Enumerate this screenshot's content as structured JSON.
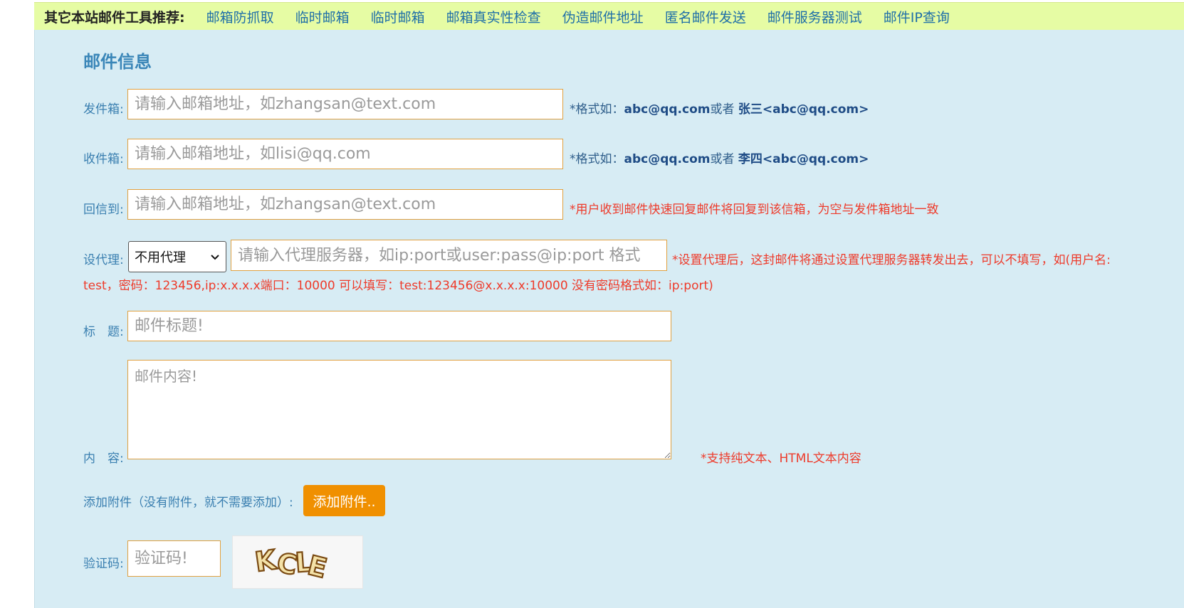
{
  "nav": {
    "title": "其它本站邮件工具推荐:",
    "links": [
      "邮箱防抓取",
      "临时邮箱",
      "临时邮箱",
      "邮箱真实性检查",
      "伪造邮件地址",
      "匿名邮件发送",
      "邮件服务器测试",
      "邮件IP查询"
    ]
  },
  "form": {
    "heading": "邮件信息",
    "from": {
      "label": "发件箱:",
      "placeholder": "请输入邮箱地址，如zhangsan@text.com",
      "hint_prefix": "*格式如：",
      "hint_ex1": "abc@qq.com",
      "hint_or": "或者 ",
      "hint_ex2": "张三<abc@qq.com>"
    },
    "to": {
      "label": "收件箱:",
      "placeholder": "请输入邮箱地址，如lisi@qq.com",
      "hint_prefix": "*格式如：",
      "hint_ex1": "abc@qq.com",
      "hint_or": "或者 ",
      "hint_ex2": "李四<abc@qq.com>"
    },
    "reply_to": {
      "label": "回信到:",
      "placeholder": "请输入邮箱地址，如zhangsan@text.com",
      "hint": "*用户收到邮件快速回复邮件将回复到该信箱，为空与发件箱地址一致"
    },
    "proxy": {
      "label": "设代理:",
      "select_value": "不用代理",
      "placeholder": "请输入代理服务器，如ip:port或user:pass@ip:port 格式",
      "hint_line1": "*设置代理后，这封邮件将通过设置代理服务器转发出去，可以不填写，如(用户名:",
      "hint_line2": "test，密码：123456,ip:x.x.x.x端口：10000 可以填写：test:123456@x.x.x.x:10000 没有密码格式如：ip:port)"
    },
    "subject": {
      "label": "标　题:",
      "placeholder": "邮件标题!"
    },
    "content": {
      "label": "内　容:",
      "placeholder": "邮件内容!",
      "hint": "*支持纯文本、HTML文本内容"
    },
    "attachment": {
      "label": "添加附件（没有附件，就不需要添加）:",
      "button": "添加附件.."
    },
    "captcha": {
      "label": "验证码:",
      "placeholder": "验证码!",
      "image_text": "KCLE"
    }
  }
}
